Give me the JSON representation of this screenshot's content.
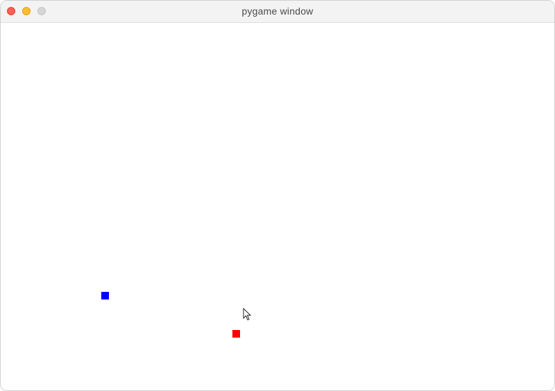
{
  "window": {
    "title": "pygame window",
    "controls": {
      "close_color": "#fe5f57",
      "minimize_color": "#febc2e",
      "zoom_color": "#d6d6d6"
    }
  },
  "canvas": {
    "background": "#ffffff",
    "sprites": [
      {
        "name": "blue-square",
        "color": "#0000ff"
      },
      {
        "name": "red-square",
        "color": "#ff0000"
      }
    ],
    "cursor_icon": "arrow-pointer-icon"
  }
}
